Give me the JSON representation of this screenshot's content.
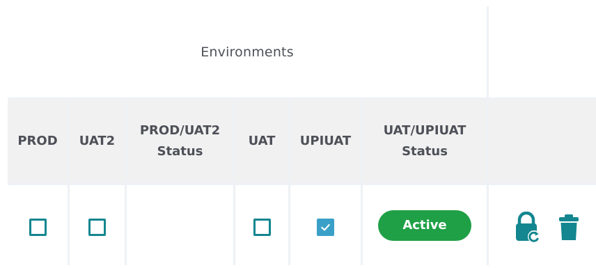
{
  "table": {
    "group_header": "Environments",
    "columns": [
      {
        "label": "PROD"
      },
      {
        "label": "UAT2"
      },
      {
        "label": "PROD/UAT2\nStatus"
      },
      {
        "label": "UAT"
      },
      {
        "label": "UPIUAT"
      },
      {
        "label": "UAT/UPIUAT\nStatus"
      },
      {
        "label": ""
      }
    ],
    "row": {
      "prod_checked": false,
      "uat2_checked": false,
      "prod_uat2_status": "",
      "uat_checked": false,
      "upiuat_checked": true,
      "uat_upiuat_status": "Active"
    }
  },
  "icons": {
    "reset_lock": "lock-reset-icon",
    "delete": "trash-icon",
    "checkmark": "checkmark-icon"
  },
  "colors": {
    "accent_teal": "#13868f",
    "checked_fill": "#3aa0c7",
    "status_active": "#1fa046",
    "header_bg": "#f1f1f1",
    "grid_lines": "#eef1f6",
    "text": "#4e5058"
  }
}
